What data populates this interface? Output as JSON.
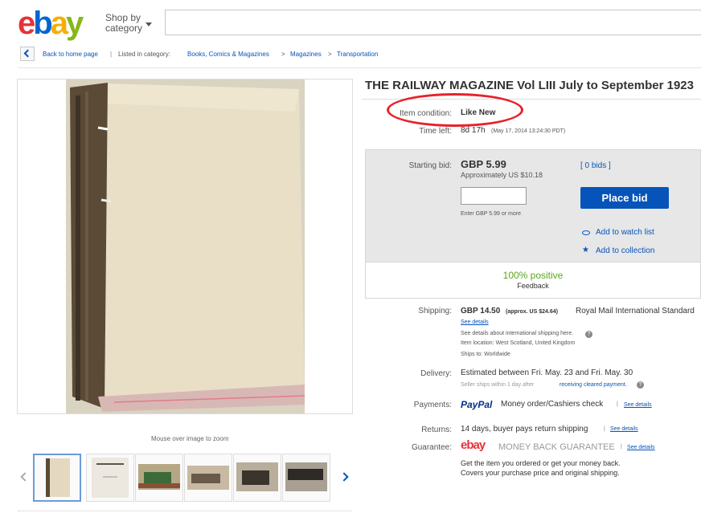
{
  "header": {
    "logo_letters": [
      "e",
      "b",
      "a",
      "y"
    ],
    "logo_colors": [
      "#e53238",
      "#0064d2",
      "#f5af02",
      "#86b817"
    ],
    "shop_by": "Shop by",
    "category": "category",
    "search_placeholder": ""
  },
  "breadcrumb": {
    "back": "Back to home page",
    "listed": "Listed in category:",
    "items": [
      "Books, Comics & Magazines",
      "Magazines",
      "Transportation"
    ],
    "sep": ">"
  },
  "gallery": {
    "zoom_hint": "Mouse over image to zoom",
    "thumbnail_count": 6,
    "selected_thumbnail": 1
  },
  "item": {
    "title": "THE RAILWAY MAGAZINE Vol LIII July to September 1923",
    "condition_label": "Item condition:",
    "condition_value": "Like New",
    "time_left_label": "Time left:",
    "time_left_value": "8d 17h",
    "time_left_date": "(May 17, 2014    13:24:30 PDT)"
  },
  "bid": {
    "starting_label": "Starting bid:",
    "price": "GBP 5.99",
    "approx": "Approximately US $10.18",
    "bids_link": "[ 0 bids ]",
    "input_value": "",
    "enter_hint": "Enter GBP 5.99 or more",
    "place_bid": "Place bid",
    "watch": "Add to watch list",
    "collection": "Add to collection"
  },
  "seller": {
    "positive": "100% positive",
    "feedback": "Feedback"
  },
  "shipping": {
    "label": "Shipping:",
    "price": "GBP 14.50",
    "approx": "(approx. US $24.64)",
    "service": "Royal Mail International Standard",
    "see_details": "See details",
    "intl_note": "See details about international shipping here.",
    "location": "Item location:  West Scotland, United Kingdom",
    "ships_to": "Ships to:  Worldwide"
  },
  "delivery": {
    "label": "Delivery:",
    "value": "Estimated between Fri. May. 23 and Fri. May. 30",
    "note": "Seller ships within 1 day after",
    "note_link": "receiving cleared payment."
  },
  "payments": {
    "label": "Payments:",
    "paypal": "PayPal",
    "other": "Money order/Cashiers check",
    "see_details": "See details"
  },
  "returns": {
    "label": "Returns:",
    "value": "14 days, buyer pays return shipping",
    "see_details": "See details"
  },
  "guarantee": {
    "label": "Guarantee:",
    "brand": "ebay",
    "text": "MONEY BACK GUARANTEE",
    "see_details": "See details",
    "line1": "Get the item you ordered or get your money back.",
    "line2": "Covers your purchase price and original shipping."
  }
}
